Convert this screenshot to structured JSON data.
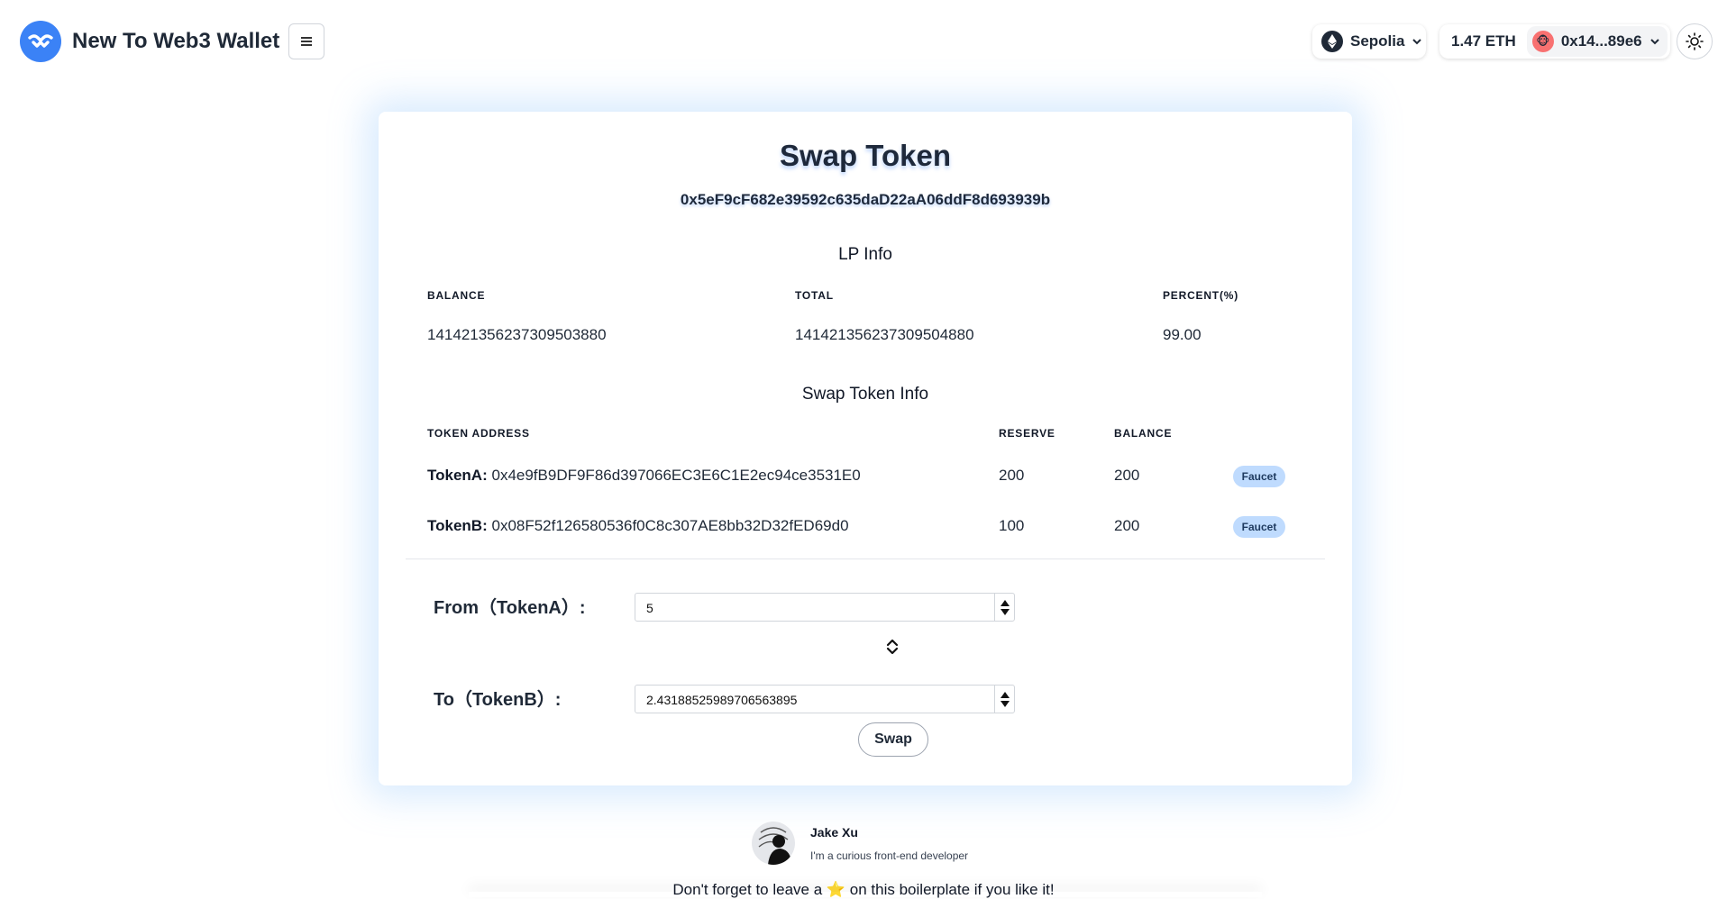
{
  "header": {
    "app_name": "New To Web3 Wallet",
    "network": "Sepolia",
    "balance": "1.47 ETH",
    "account": "0x14...89e6"
  },
  "card": {
    "title": "Swap Token",
    "contract_address": "0x5eF9cF682e39592c635daD22aA06ddF8d693939b",
    "lp_info": {
      "title": "LP Info",
      "headers": [
        "BALANCE",
        "TOTAL",
        "PERCENT(%)"
      ],
      "row": [
        "141421356237309503880",
        "141421356237309504880",
        "99.00"
      ]
    },
    "token_info": {
      "title": "Swap Token Info",
      "headers": [
        "TOKEN ADDRESS",
        "RESERVE",
        "BALANCE"
      ],
      "rows": [
        {
          "name": "TokenA:",
          "address": "0x4e9fB9DF9F86d397066EC3E6C1E2ec94ce3531E0",
          "reserve": "200",
          "balance": "200",
          "action": "Faucet"
        },
        {
          "name": "TokenB:",
          "address": "0x08F52f126580536f0C8c307AE8bb32D32fED69d0",
          "reserve": "100",
          "balance": "200",
          "action": "Faucet"
        }
      ]
    },
    "form": {
      "from_label": "From（TokenA）:",
      "from_value": "5",
      "to_label": "To（TokenB）:",
      "to_value": "2.43188525989706563895",
      "swap_label": "Swap"
    }
  },
  "footer": {
    "author_name": "Jake Xu",
    "author_bio": "I'm a curious front-end developer",
    "note": "Don't forget to leave a ⭐ on this boilerplate if you like it!"
  },
  "colors": {
    "brand": "#3b82f6",
    "faucet_bg": "#bfdbfe",
    "card_glow": "#93c5fd"
  }
}
